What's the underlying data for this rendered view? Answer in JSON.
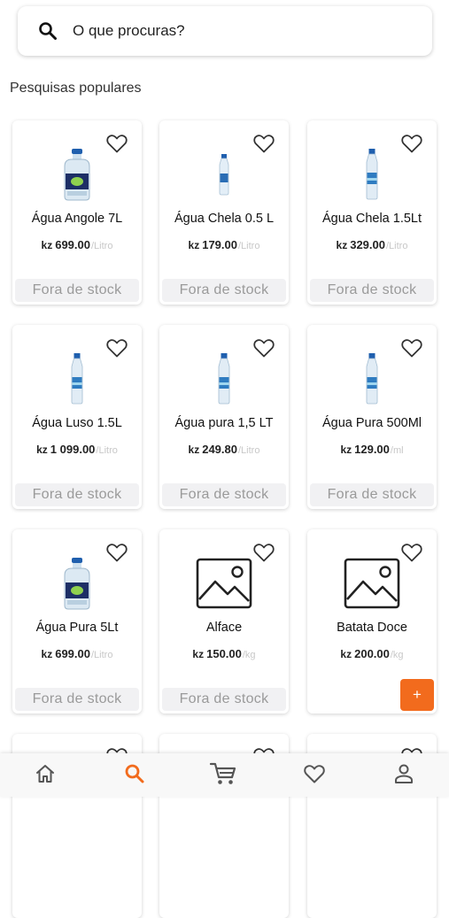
{
  "search": {
    "placeholder": "O que procuras?",
    "icon": "search-icon"
  },
  "section_title": "Pesquisas populares",
  "products": [
    {
      "name": "Água Angole 7L",
      "currency": "kz",
      "price": "699.00",
      "unit": "/Litro",
      "stock": "Fora de stock",
      "image": "water-jug-icon"
    },
    {
      "name": "Água Chela 0.5 L",
      "currency": "kz",
      "price": "179.00",
      "unit": "/Litro",
      "stock": "Fora de stock",
      "image": "water-bottle-small-icon"
    },
    {
      "name": "Água Chela 1.5Lt",
      "currency": "kz",
      "price": "329.00",
      "unit": "/Litro",
      "stock": "Fora de stock",
      "image": "water-bottle-icon"
    },
    {
      "name": "Água Luso 1.5L",
      "currency": "kz",
      "price": "1 099.00",
      "unit": "/Litro",
      "stock": "Fora de stock",
      "image": "water-bottle-icon"
    },
    {
      "name": "Água pura 1,5 LT",
      "currency": "kz",
      "price": "249.80",
      "unit": "/Litro",
      "stock": "Fora de stock",
      "image": "water-bottle-icon"
    },
    {
      "name": "Água Pura 500Ml",
      "currency": "kz",
      "price": "129.00",
      "unit": "/ml",
      "stock": "Fora de stock",
      "image": "water-bottle-icon"
    },
    {
      "name": "Água Pura 5Lt",
      "currency": "kz",
      "price": "699.00",
      "unit": "/Litro",
      "stock": "Fora de stock",
      "image": "water-jug-icon"
    },
    {
      "name": "Alface",
      "currency": "kz",
      "price": "150.00",
      "unit": "/kg",
      "stock": "Fora de stock",
      "image": "image-placeholder-icon"
    },
    {
      "name": "Batata Doce",
      "currency": "kz",
      "price": "200.00",
      "unit": "/kg",
      "add_label": "+",
      "image": "image-placeholder-icon"
    }
  ],
  "nav": [
    {
      "name": "home",
      "icon": "home-icon",
      "active": false
    },
    {
      "name": "search",
      "icon": "search-icon",
      "active": true
    },
    {
      "name": "cart",
      "icon": "cart-icon",
      "active": false
    },
    {
      "name": "favorites",
      "icon": "heart-icon",
      "active": false
    },
    {
      "name": "profile",
      "icon": "user-icon",
      "active": false
    }
  ],
  "colors": {
    "accent": "#f26b1d",
    "out_of_stock_bg": "#f1f1f3",
    "nav_icon": "#555555"
  }
}
